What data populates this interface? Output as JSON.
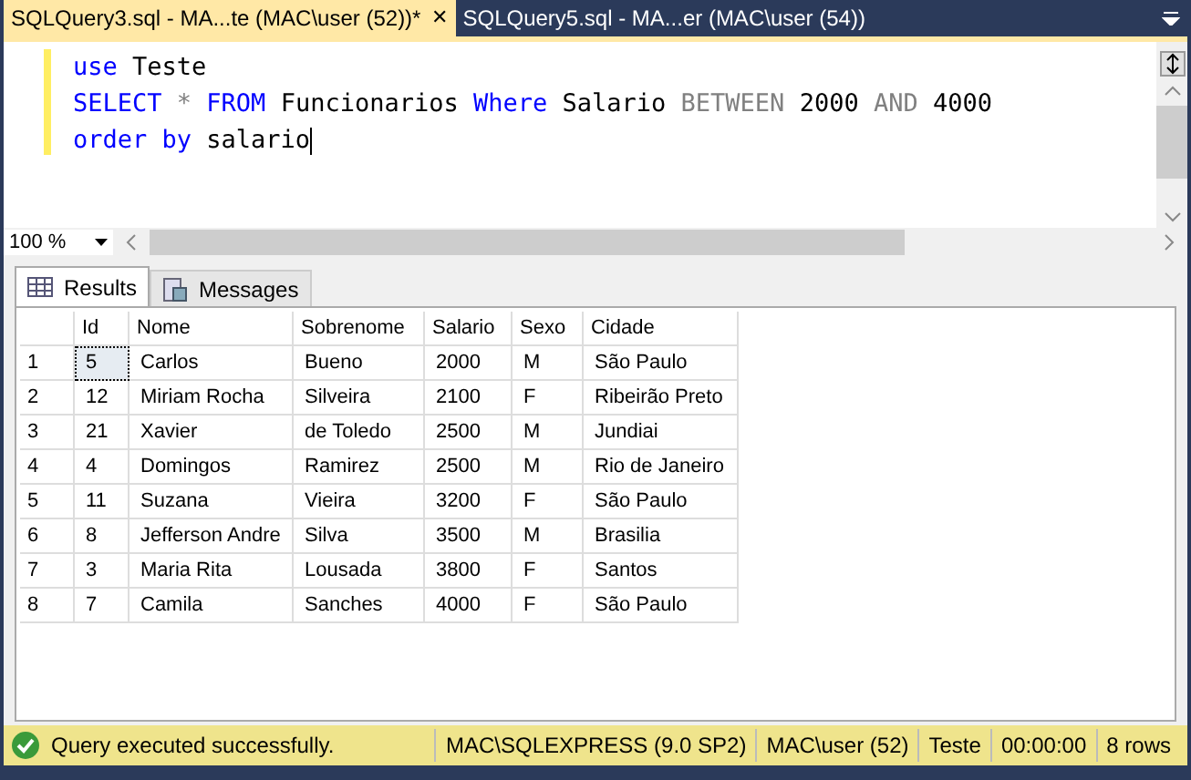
{
  "document_tabs": [
    {
      "label": "SQLQuery3.sql - MA...te (MAC\\user (52))*",
      "selected": true,
      "close": "✕"
    },
    {
      "label": "SQLQuery5.sql - MA...er (MAC\\user (54))",
      "selected": false
    }
  ],
  "editor": {
    "lines": [
      [
        {
          "kind": "keyword",
          "text": "use"
        },
        {
          "kind": "plain",
          "text": " Teste"
        }
      ],
      [
        {
          "kind": "keyword",
          "text": "SELECT"
        },
        {
          "kind": "operator",
          "text": " * "
        },
        {
          "kind": "keyword",
          "text": "FROM"
        },
        {
          "kind": "plain",
          "text": " Funcionarios "
        },
        {
          "kind": "keyword",
          "text": "Where"
        },
        {
          "kind": "plain",
          "text": " Salario "
        },
        {
          "kind": "operator",
          "text": "BETWEEN"
        },
        {
          "kind": "plain",
          "text": " 2000 "
        },
        {
          "kind": "operator",
          "text": "AND"
        },
        {
          "kind": "plain",
          "text": " 4000"
        }
      ],
      [
        {
          "kind": "keyword",
          "text": "order"
        },
        {
          "kind": "keyword",
          "text": " by"
        },
        {
          "kind": "plain",
          "text": " salario"
        }
      ]
    ],
    "zoom": "100 %"
  },
  "result_tabs": [
    {
      "label": "Results",
      "selected": true
    },
    {
      "label": "Messages",
      "selected": false
    }
  ],
  "table": {
    "columns": [
      "Id",
      "Nome",
      "Sobrenome",
      "Salario",
      "Sexo",
      "Cidade"
    ],
    "rows": [
      {
        "number": "1",
        "cells": [
          "5",
          "Carlos",
          "Bueno",
          "2000",
          "M",
          "São Paulo"
        ],
        "focused": true
      },
      {
        "number": "2",
        "cells": [
          "12",
          "Miriam Rocha",
          "Silveira",
          "2100",
          "F",
          "Ribeirão Preto"
        ],
        "focused": false
      },
      {
        "number": "3",
        "cells": [
          "21",
          "Xavier",
          "de Toledo",
          "2500",
          "M",
          "Jundiai"
        ],
        "focused": false
      },
      {
        "number": "4",
        "cells": [
          "4",
          "Domingos",
          "Ramirez",
          "2500",
          "M",
          "Rio de Janeiro"
        ],
        "focused": false
      },
      {
        "number": "5",
        "cells": [
          "11",
          "Suzana",
          "Vieira",
          "3200",
          "F",
          "São Paulo"
        ],
        "focused": false
      },
      {
        "number": "6",
        "cells": [
          "8",
          "Jefferson Andre",
          "Silva",
          "3500",
          "M",
          "Brasilia"
        ],
        "focused": false
      },
      {
        "number": "7",
        "cells": [
          "3",
          "Maria Rita",
          "Lousada",
          "3800",
          "F",
          "Santos"
        ],
        "focused": false
      },
      {
        "number": "8",
        "cells": [
          "7",
          "Camila",
          "Sanches",
          "4000",
          "F",
          "São Paulo"
        ],
        "focused": false
      }
    ]
  },
  "status_bar": {
    "message": "Query executed successfully.",
    "fields": [
      "MAC\\SQLEXPRESS (9.0 SP2)",
      "MAC\\user (52)",
      "Teste",
      "00:00:00",
      "8 rows"
    ]
  }
}
